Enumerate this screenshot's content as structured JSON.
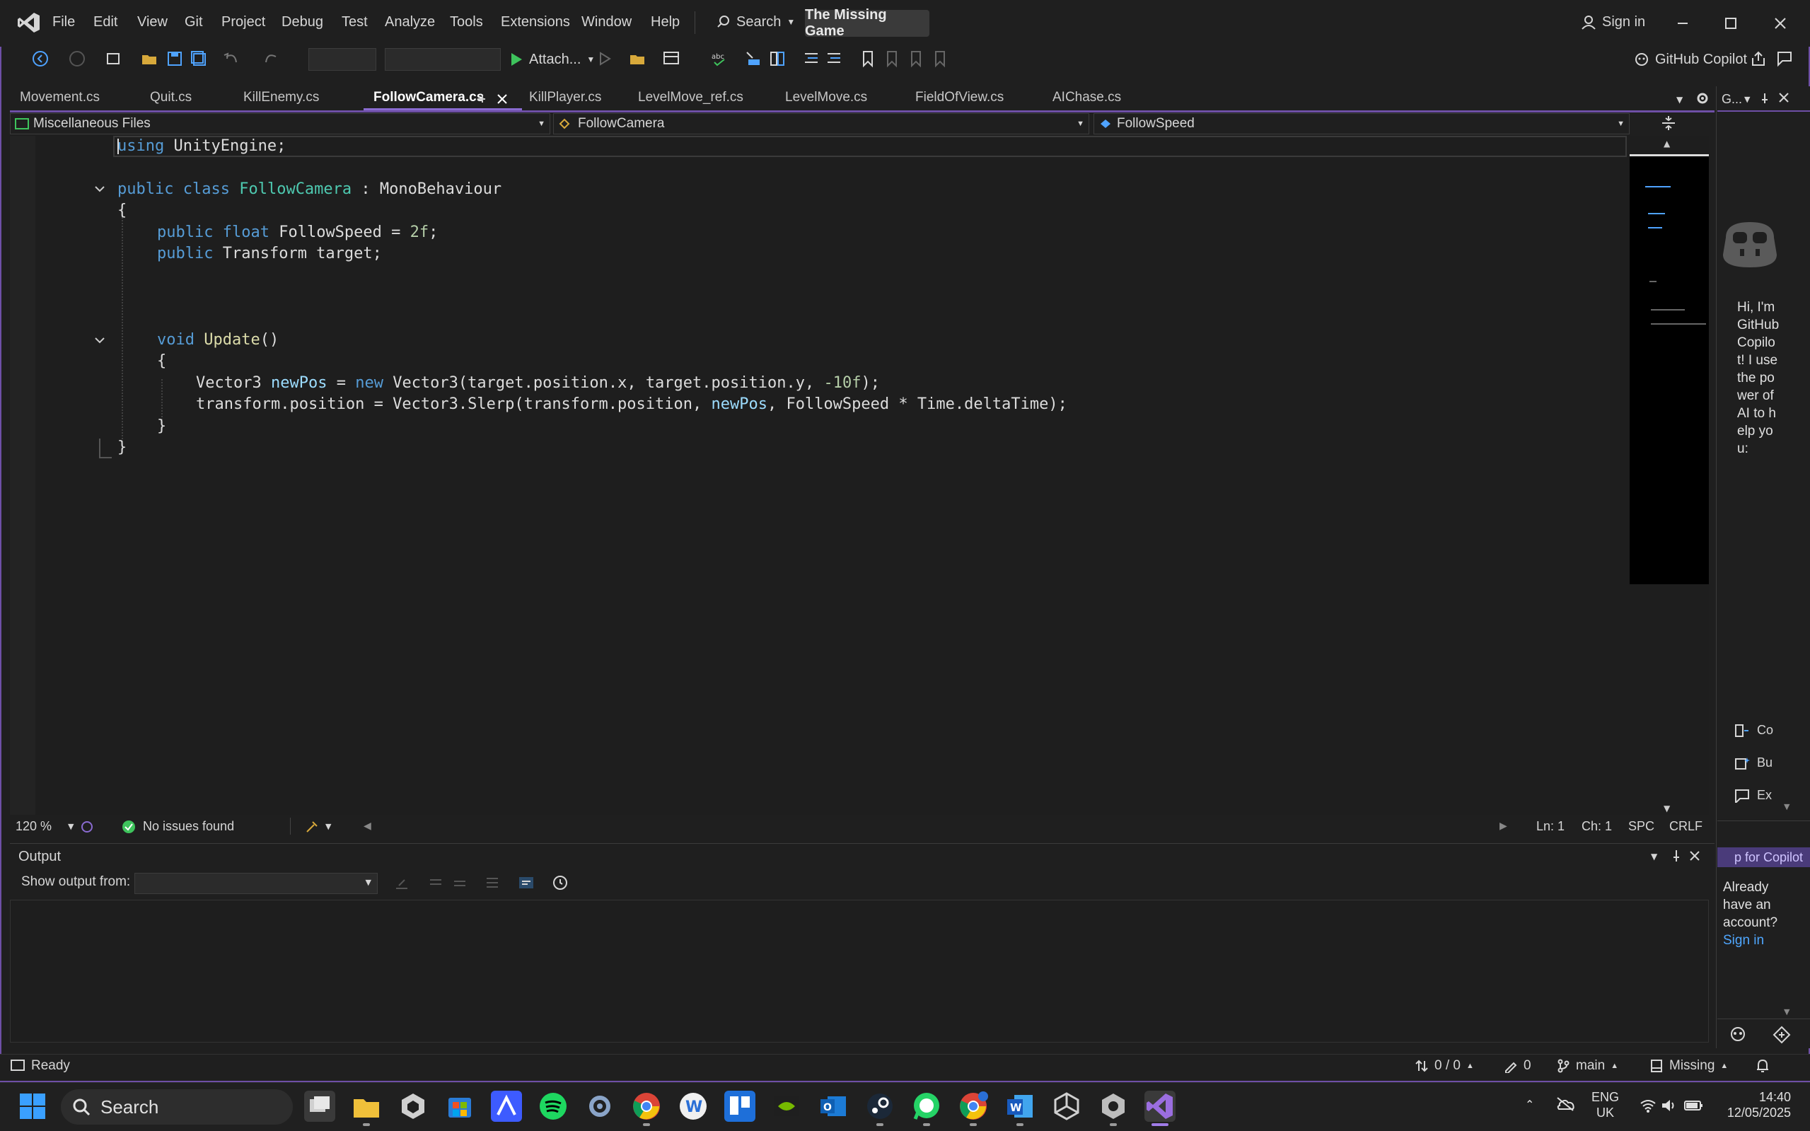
{
  "menu": [
    "File",
    "Edit",
    "View",
    "Git",
    "Project",
    "Debug",
    "Test",
    "Analyze",
    "Tools",
    "Extensions",
    "Window",
    "Help"
  ],
  "search_label": "Search",
  "solution_name": "The Missing Game",
  "sign_in": "Sign in",
  "toolbar": {
    "attach_label": "Attach...",
    "copilot_label": "GitHub Copilot"
  },
  "tabs": [
    "Movement.cs",
    "Quit.cs",
    "KillEnemy.cs",
    "FollowCamera.cs",
    "KillPlayer.cs",
    "LevelMove_ref.cs",
    "LevelMove.cs",
    "FieldOfView.cs",
    "AIChase.cs"
  ],
  "active_tab": "FollowCamera.cs",
  "navbar": {
    "project": "Miscellaneous Files",
    "type": "FollowCamera",
    "member": "FollowSpeed"
  },
  "code": {
    "l1_kw": "using",
    "l1_rest": " UnityEngine;",
    "l3_pub": "public",
    "l3_class": "class",
    "l3_name": "FollowCamera",
    "l3_rest": " : MonoBehaviour",
    "l4": "{",
    "l5_pub": "public",
    "l5_float": "float",
    "l5_name": " FollowSpeed = ",
    "l5_num": "2f",
    "l5_end": ";",
    "l6_pub": "public",
    "l6_rest": " Transform target;",
    "l9_void": "void",
    "l9_fn": "Update",
    "l9_end": "()",
    "l10": "{",
    "l11_a": "Vector3 ",
    "l11_var": "newPos",
    "l11_b": " = ",
    "l11_new": "new",
    "l11_c": " Vector3(target.position.x, target.position.y, ",
    "l11_num": "-10f",
    "l11_d": ");",
    "l12_a": "transform.position = Vector3.Slerp(transform.position, ",
    "l12_var": "newPos",
    "l12_b": ", FollowSpeed * Time.deltaTime);",
    "l13": "}",
    "l14": "}"
  },
  "editor_status": {
    "zoom": "120 %",
    "issues": "No issues found",
    "line": "Ln: 1",
    "col": "Ch: 1",
    "spacing": "SPC",
    "eol": "CRLF"
  },
  "output": {
    "title": "Output",
    "show_from": "Show output from:"
  },
  "copilot": {
    "header": "G...",
    "greeting": "Hi, I'm GitHub Copilot! I use the power of AI to help you:",
    "actions": [
      "Co",
      "Bu",
      "Ex"
    ],
    "signup": "p for Copilot",
    "already": "Already have an account?",
    "signin": "Sign in"
  },
  "statusbar": {
    "ready": "Ready",
    "changes": "0 / 0",
    "edits": "0",
    "branch": "main",
    "repo": "Missing"
  },
  "taskbar": {
    "search": "Search",
    "lang1": "ENG",
    "lang2": "UK",
    "time": "14:40",
    "date": "12/05/2025"
  },
  "colors": {
    "accent": "#6e4fa6",
    "keyword": "#569cd6",
    "type": "#4ec9b0",
    "method": "#dcdcaa",
    "number": "#b5cea8"
  }
}
